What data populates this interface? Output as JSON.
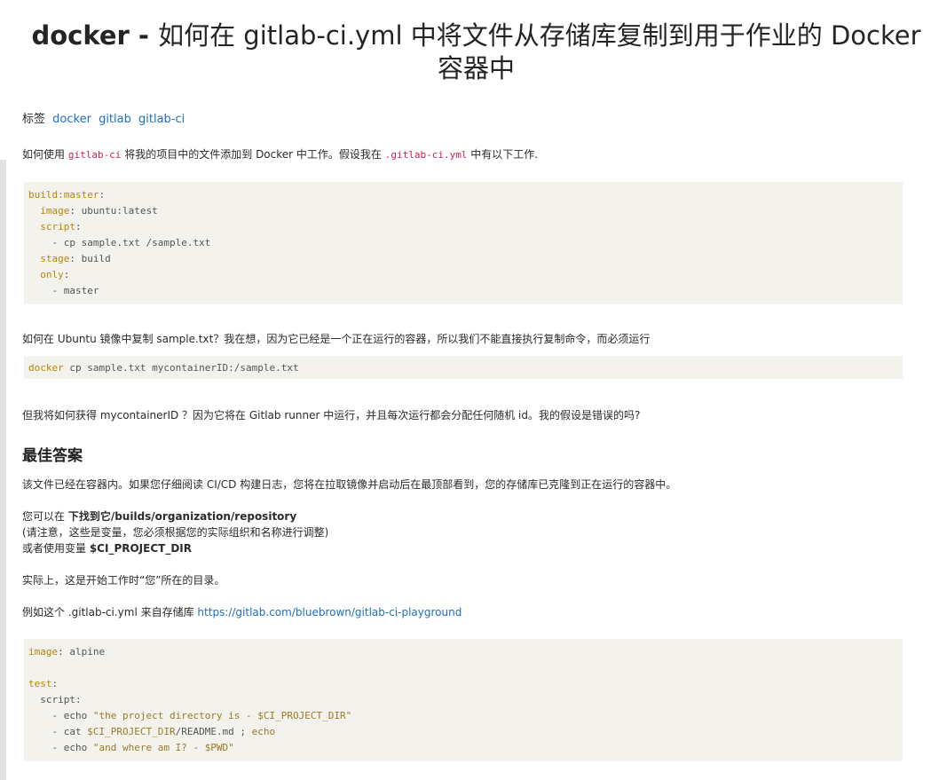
{
  "title_latin_1": "docker - ",
  "title_cjk": "如何在 gitlab-ci.yml 中将文件从存储库复制到用于作业的 Docker 容器中",
  "tags_label": "标签",
  "tags": [
    "docker",
    "gitlab",
    "gitlab-ci"
  ],
  "q_p1_a": "如何使用 ",
  "q_p1_code1": "gitlab-ci",
  "q_p1_b": " 将我的项目中的文件添加到 Docker 中工作。假设我在 ",
  "q_p1_code2": ".gitlab-ci.yml",
  "q_p1_c": " 中有以下工作.",
  "code1": [
    {
      "k": "build:master",
      "p": ":"
    },
    {
      "i": "  ",
      "k": "image",
      "p": ": ubuntu:latest"
    },
    {
      "i": "  ",
      "k": "script",
      "p": ":"
    },
    {
      "i": "    ",
      "p": "- cp sample.txt /sample.txt"
    },
    {
      "i": "  ",
      "k": "stage",
      "p": ": build"
    },
    {
      "i": "  ",
      "k": "only",
      "p": ":"
    },
    {
      "i": "    ",
      "p": "- master"
    }
  ],
  "q_p2": "如何在 Ubuntu 镜像中复制 sample.txt？我在想，因为它已经是一个正在运行的容器，所以我们不能直接执行复制命令，而必须运行",
  "code2_k": "docker",
  "code2_rest": " cp sample.txt mycontainerID:/sample.txt",
  "q_p3": "但我将如何获得 mycontainerID ？因为它将在 Gitlab runner 中运行，并且每次运行都会分配任何随机 id。我的假设是错误的吗?",
  "best_answer": "最佳答案",
  "a_p1": "该文件已经在容器内。如果您仔细阅读 CI/CD 构建日志，您将在拉取镜像并启动后在最顶部看到，您的存储库已克隆到正在运行的容器中。",
  "a_p2_a": "您可以在 ",
  "a_p2_bold": "下找到它/builds/organization/repository",
  "a_p2_line2": "(请注意，这些是变量，您必须根据您的实际组织和名称进行调整)",
  "a_p2_line3_a": "或者使用变量 ",
  "a_p2_line3_bold": "$CI_PROJECT_DIR",
  "a_p3": "实际上，这是开始工作时“您”所在的目录。",
  "a_p4_a": "例如这个 .gitlab-ci.yml 来自存储库 ",
  "a_p4_link": "https://gitlab.com/bluebrown/gitlab-ci-playground",
  "code3_l1_k": "image",
  "code3_l1_p": ": alpine",
  "code3_l3_k": "test",
  "code3_l3_p": ":",
  "code3_l4": "  script:",
  "code3_l5_a": "    - echo ",
  "code3_l5_s": "\"the project directory is - $CI_PROJECT_DIR\"",
  "code3_l6_a": "    - cat ",
  "code3_l6_v": "$CI_PROJECT_DIR",
  "code3_l6_b": "/README.md ; ",
  "code3_l6_e": "echo",
  "code3_l7_a": "    - echo ",
  "code3_l7_s": "\"and where am I? - $PWD\""
}
